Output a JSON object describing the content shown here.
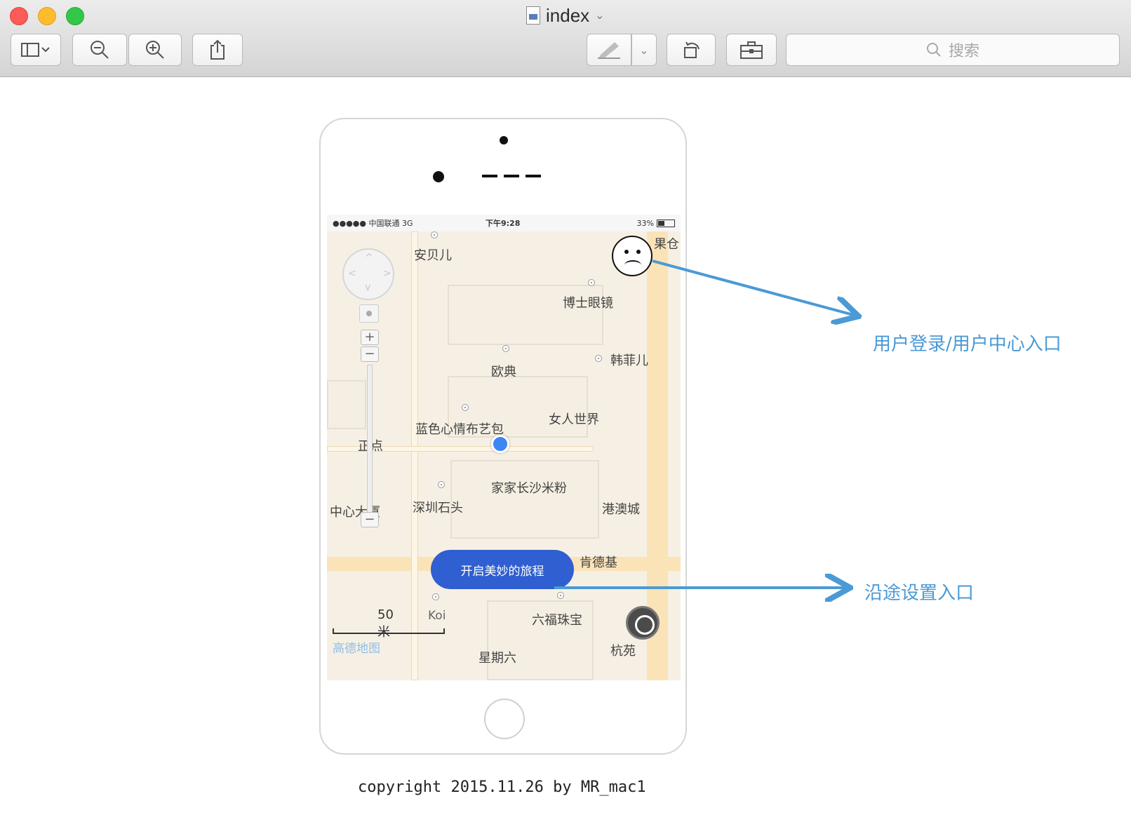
{
  "window": {
    "title": "index",
    "search_placeholder": "搜索"
  },
  "status_bar": {
    "carrier": "●●●●● 中国联通  3G",
    "time": "下午9:28",
    "battery": "33%"
  },
  "map": {
    "pois": [
      "安贝儿",
      "博士眼镜",
      "韩菲儿",
      "欧典",
      "女人世界",
      "蓝色心情布艺包",
      "正点",
      "家家长沙米粉",
      "深圳石头",
      "港澳城",
      "中心大厦",
      "肯德基",
      "六福珠宝",
      "Koi",
      "杭苑",
      "星期六",
      "果仓"
    ],
    "scale": "50 米",
    "brand": "高德地图"
  },
  "app": {
    "start_button": "开启美妙的旅程"
  },
  "annotations": {
    "login": "用户登录/用户中心入口",
    "route": "沿途设置入口"
  },
  "footer": {
    "copyright": "copyright 2015.11.26 by MR_mac1"
  },
  "colors": {
    "annotation": "#4a9ad6",
    "cta": "#2f5fd0",
    "location": "#3f86f5"
  }
}
